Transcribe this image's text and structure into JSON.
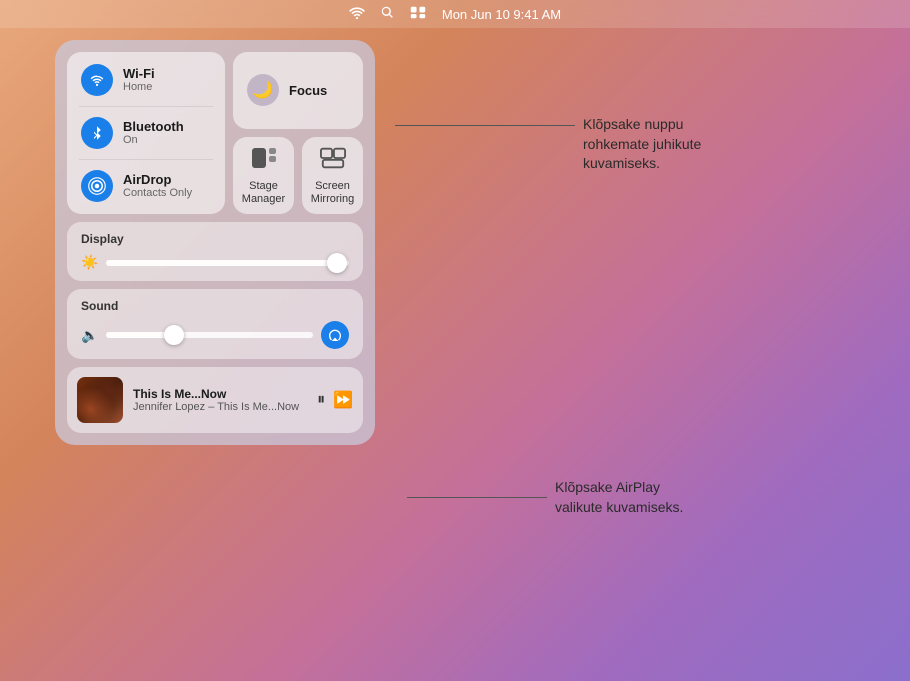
{
  "menubar": {
    "time": "Mon Jun 10  9:41 AM"
  },
  "connectivity": {
    "wifi": {
      "title": "Wi-Fi",
      "subtitle": "Home"
    },
    "bluetooth": {
      "title": "Bluetooth",
      "subtitle": "On"
    },
    "airdrop": {
      "title": "AirDrop",
      "subtitle": "Contacts Only"
    }
  },
  "focus": {
    "title": "Focus"
  },
  "stage_manager": {
    "label": "Stage\nManager"
  },
  "screen_mirroring": {
    "label": "Screen\nMirroring"
  },
  "display": {
    "section_label": "Display"
  },
  "sound": {
    "section_label": "Sound"
  },
  "now_playing": {
    "title": "This Is Me...Now",
    "artist": "Jennifer Lopez – This Is Me...Now"
  },
  "annotations": {
    "annotation1_line1": "Klõpsake nuppu",
    "annotation1_line2": "rohkemate juhikute",
    "annotation1_line3": "kuvamiseks.",
    "annotation2_line1": "Klõpsake AirPlay",
    "annotation2_line2": "valikute kuvamiseks."
  }
}
